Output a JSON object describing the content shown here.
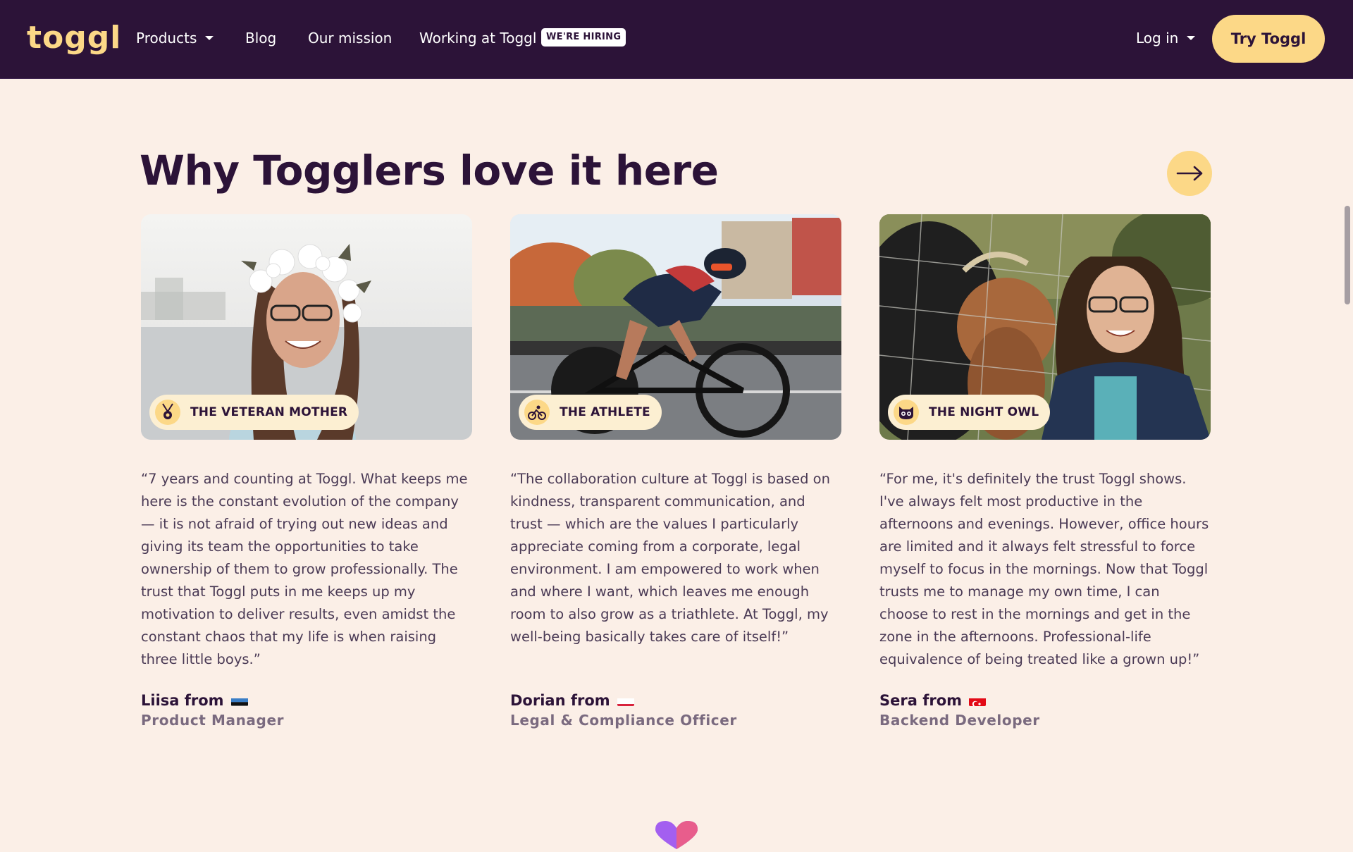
{
  "nav": {
    "logo": "toggl",
    "products": "Products",
    "blog": "Blog",
    "mission": "Our mission",
    "working": "Working at Toggl",
    "hiring_badge": "WE'RE HIRING",
    "login": "Log in",
    "try_button": "Try Toggl"
  },
  "section": {
    "title": "Why Togglers love it here"
  },
  "cards": [
    {
      "tag": "THE VETERAN MOTHER",
      "tag_icon": "medal-icon",
      "quote": "“7 years and counting at Toggl. What keeps me here is the constant evolution of the company — it is not afraid of trying out new ideas and giving its team the opportunities to take ownership of them to grow professionally. The trust that Toggl puts in me keeps up my motivation to deliver results, even amidst the constant chaos that my life is when raising three little boys.”",
      "name": "Liisa from",
      "flag": "estonia-flag-icon",
      "role": "Product Manager"
    },
    {
      "tag": "THE ATHLETE",
      "tag_icon": "cyclist-icon",
      "quote": "“The collaboration culture at Toggl is based on kindness, transparent communication, and trust — which are the values I particularly appreciate coming from a corporate, legal environment. I am empowered to work when and where I want, which leaves me enough room to also grow as a triathlete. At Toggl, my well-being basically takes care of itself!”",
      "name": "Dorian from",
      "flag": "poland-flag-icon",
      "role": "Legal & Compliance Officer"
    },
    {
      "tag": "THE NIGHT OWL",
      "tag_icon": "cat-icon",
      "quote": "“For me, it's definitely the trust Toggl shows. I've always felt most productive in the afternoons and evenings. However, office hours are limited and it always felt stressful to force myself to focus in the mornings. Now that Toggl trusts me to manage my own time, I can choose to rest in the mornings and get in the zone in the afternoons. Professional-life equivalence of being treated like a grown up!”",
      "name": "Sera from",
      "flag": "turkey-flag-icon",
      "role": "Backend Developer"
    }
  ],
  "colors": {
    "nav_bg": "#2c1338",
    "page_bg": "#fbefe7",
    "accent": "#fcd887",
    "text": "#2c1338"
  }
}
